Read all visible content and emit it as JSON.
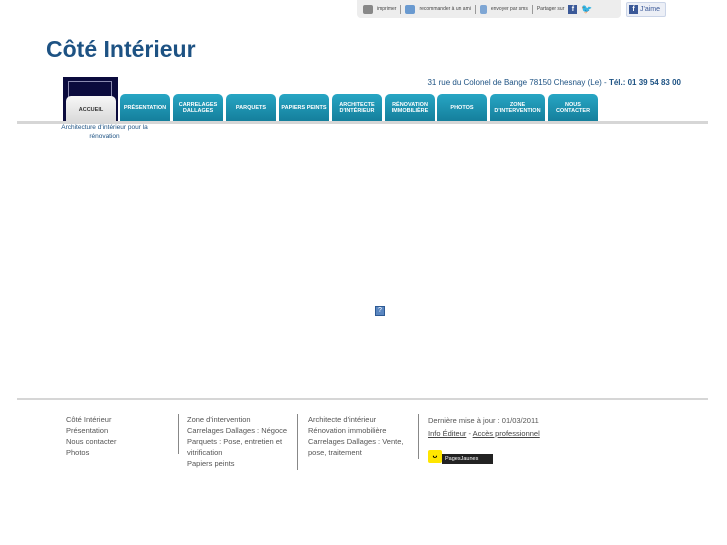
{
  "topbar": {
    "print": "imprimer",
    "recommend": "recommander à un ami",
    "sms": "envoyer par sms",
    "share": "Partager sur",
    "like": "J'aime"
  },
  "header": {
    "logo": "Côté Intérieur",
    "address": "31 rue du Colonel de Bange 78150 Chesnay (Le)  - ",
    "phone": "Tél.: 01 39 54 83 00",
    "tagline": "Architecture d'intérieur pour la rénovation"
  },
  "nav": [
    "ACCUEIL",
    "PRÉSENTATION",
    "CARRELAGES DALLAGES",
    "PARQUETS",
    "PAPIERS PEINTS",
    "ARCHITECTE D'INTÉRIEUR",
    "RÉNOVATION IMMOBILIÈRE",
    "PHOTOS",
    "ZONE D'INTERVENTION",
    "NOUS CONTACTER"
  ],
  "footer": {
    "col1": [
      "Côté Intérieur",
      "Présentation",
      "Nous contacter",
      "Photos"
    ],
    "col2": [
      "Zone d'intervention",
      "Carrelages Dallages : Négoce",
      "Parquets : Pose, entretien et vitrification",
      "Papiers peints"
    ],
    "col3": [
      "Architecte d'intérieur",
      "Rénovation immobilière",
      "Carrelages Dallages : Vente, pose, traitement"
    ],
    "updated": "Dernière mise à jour : 01/03/2011",
    "info": "Info Éditeur",
    "sep": " - ",
    "pro": "Accès professionnel",
    "badge": "PagesJaunes"
  }
}
